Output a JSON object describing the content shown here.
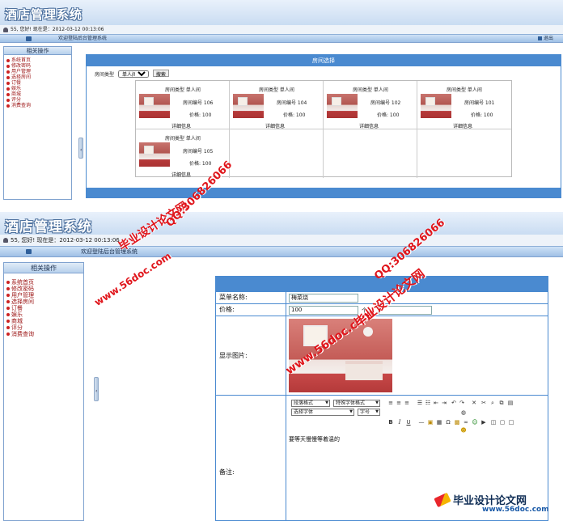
{
  "app": {
    "title": "酒店管理系统",
    "user_status": "55, 您好! 现在是：2012-03-12 00:13:06",
    "welcome": "欢迎登陆后台管理系统",
    "logout": "退出"
  },
  "sidebar": {
    "header": "相关操作",
    "items": [
      "系统首页",
      "修改密码",
      "用户管理",
      "选择房间",
      "订餐",
      "娱乐",
      "商城",
      "评分",
      "消费查询"
    ]
  },
  "room_list": {
    "panel_title": "房间选择",
    "filter_label": "房间类型",
    "filter_value": "单人间",
    "filter_button": "搜索",
    "rooms": [
      {
        "type": "房间类型 单人间",
        "number": "房间编号 106",
        "price": "价格: 100",
        "detail": "详细信息"
      },
      {
        "type": "房间类型 单人间",
        "number": "房间编号 104",
        "price": "价格: 100",
        "detail": "详细信息"
      },
      {
        "type": "房间类型 单人间",
        "number": "房间编号 102",
        "price": "价格: 100",
        "detail": "详细信息"
      },
      {
        "type": "房间类型 单人间",
        "number": "房间编号 101",
        "price": "价格: 100",
        "detail": "详细信息"
      },
      {
        "type": "房间类型 单人间",
        "number": "房间编号 105",
        "price": "价格: 100",
        "detail": "详细信息"
      }
    ]
  },
  "menu_form": {
    "name_label": "菜单名称:",
    "name_value": "梅菜烧",
    "price_label": "价格:",
    "price_value": "100",
    "price_extra": "个",
    "image_label": "显示图片:",
    "remark_label": "备注:",
    "editor": {
      "paragraph_select": "段落格式",
      "style_select": "特殊字体格式",
      "font_select": "选择字体",
      "size_select": "字号",
      "content": "要等天慢慢等着温的"
    }
  },
  "watermarks": {
    "site": "www.56doc.com",
    "qq": "QQ:306826066",
    "brand": "毕业设计论文网",
    "footer_site": "www.56doc.com"
  },
  "colors": {
    "accent": "#4a8ad0",
    "menu_text": "#9a1010",
    "watermark": "#e0151b"
  }
}
